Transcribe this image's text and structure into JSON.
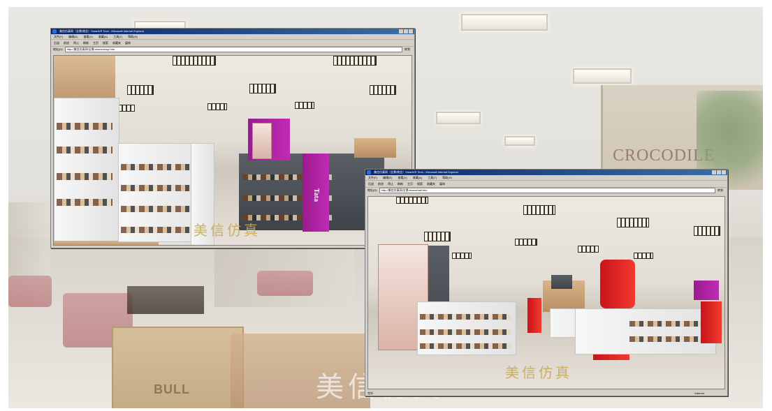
{
  "background": {
    "brand_sign": "CROCODILE",
    "box_brand": "BULL",
    "watermark": "美信仿真"
  },
  "window_left": {
    "title": "美信仿真网（全景/商业）SmartVR Tech - Microsoft Internet Explorer",
    "menu": [
      "文件(F)",
      "编辑(E)",
      "查看(V)",
      "收藏(A)",
      "工具(T)",
      "帮助(H)"
    ],
    "toolbar": [
      "后退",
      "前进",
      "停止",
      "刷新",
      "主页",
      "搜索",
      "收藏夹",
      "媒体"
    ],
    "address_label": "地址(D)",
    "address_value": "http://美信仿真网/全景/shoes/shop.htm",
    "go_label": "转到",
    "watermark": "美信仿真",
    "pillar_text": "Tata"
  },
  "window_right": {
    "title": "美信仿真网（全景/商业）SmartVR Tech - Microsoft Internet Explorer",
    "menu": [
      "文件(F)",
      "编辑(E)",
      "查看(V)",
      "收藏(A)",
      "工具(T)",
      "帮助(H)"
    ],
    "toolbar": [
      "后退",
      "前进",
      "停止",
      "刷新",
      "主页",
      "搜索",
      "收藏夹",
      "媒体"
    ],
    "address_label": "地址(D)",
    "address_value": "http://美信仿真网/全景/shoes/hall.htm",
    "go_label": "转到",
    "watermark": "美信仿真",
    "status_left": "完毕",
    "status_right": "Internet"
  },
  "colors": {
    "title_bar": "#0a246a",
    "accent_purple": "#b02aa6",
    "accent_red": "#e02a23"
  }
}
